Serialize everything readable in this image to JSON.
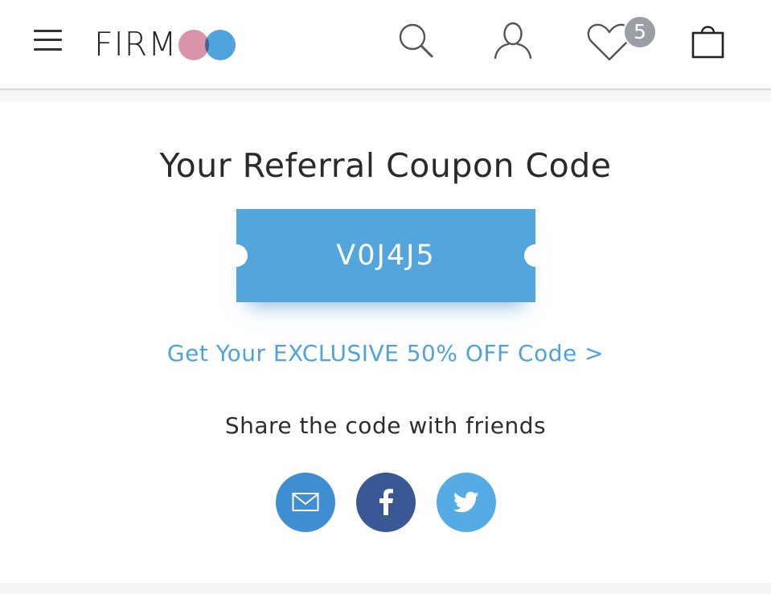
{
  "header": {
    "logo_text": "FIRM",
    "wishlist_count": "5",
    "icons": {
      "menu": "hamburger-menu-icon",
      "search": "search-icon",
      "account": "user-icon",
      "wishlist": "heart-icon",
      "cart": "shopping-bag-icon"
    }
  },
  "main": {
    "title": "Your Referral Coupon Code",
    "coupon_code": "V0J4J5",
    "offer_link": "Get Your EXCLUSIVE 50% OFF Code >",
    "share_text": "Share the code with friends",
    "share_buttons": [
      {
        "name": "email",
        "icon": "mail-icon",
        "color": "#3f8ed1"
      },
      {
        "name": "facebook",
        "icon": "facebook-icon",
        "color": "#3b5896"
      },
      {
        "name": "twitter",
        "icon": "twitter-icon",
        "color": "#55ace4"
      }
    ]
  },
  "colors": {
    "accent": "#52a6dc",
    "link": "#4fa3dd",
    "logo_pink": "#d993a8",
    "logo_blue": "#4fa3dd",
    "badge": "#9a9fa6"
  }
}
